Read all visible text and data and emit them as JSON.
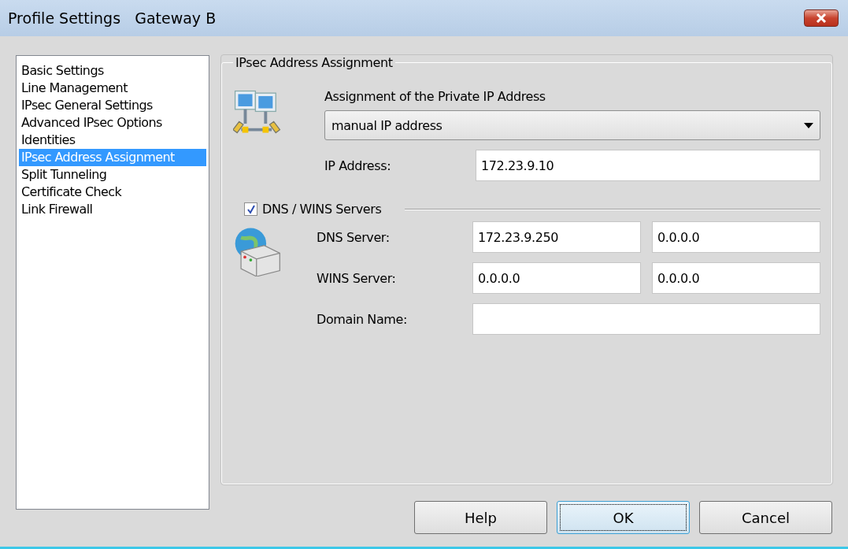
{
  "window": {
    "title": "Profile Settings   Gateway B"
  },
  "sidebar": {
    "items": [
      {
        "label": "Basic Settings",
        "selected": false
      },
      {
        "label": "Line Management",
        "selected": false
      },
      {
        "label": "IPsec General Settings",
        "selected": false
      },
      {
        "label": "Advanced IPsec Options",
        "selected": false
      },
      {
        "label": "Identities",
        "selected": false
      },
      {
        "label": "IPsec Address Assignment",
        "selected": true
      },
      {
        "label": "Split Tunneling",
        "selected": false
      },
      {
        "label": "Certificate Check",
        "selected": false
      },
      {
        "label": "Link Firewall",
        "selected": false
      }
    ]
  },
  "group": {
    "title": "IPsec Address Assignment",
    "assignment": {
      "label": "Assignment of the Private IP Address",
      "value": "manual IP address"
    },
    "ip_address": {
      "label": "IP Address:",
      "value": "172.23.9.10"
    },
    "dns_wins": {
      "label": "DNS / WINS Servers",
      "checked": true,
      "rows": [
        {
          "kind": "pair",
          "label": "DNS Server:",
          "values": [
            "172.23.9.250",
            "0.0.0.0"
          ]
        },
        {
          "kind": "pair",
          "label": "WINS Server:",
          "values": [
            "0.0.0.0",
            "0.0.0.0"
          ]
        },
        {
          "kind": "text",
          "label": "Domain Name:"
        }
      ]
    }
  },
  "buttons": [
    {
      "label": "Help",
      "focused": false
    },
    {
      "label": "OK",
      "focused": true
    },
    {
      "label": "Cancel",
      "focused": false
    }
  ]
}
